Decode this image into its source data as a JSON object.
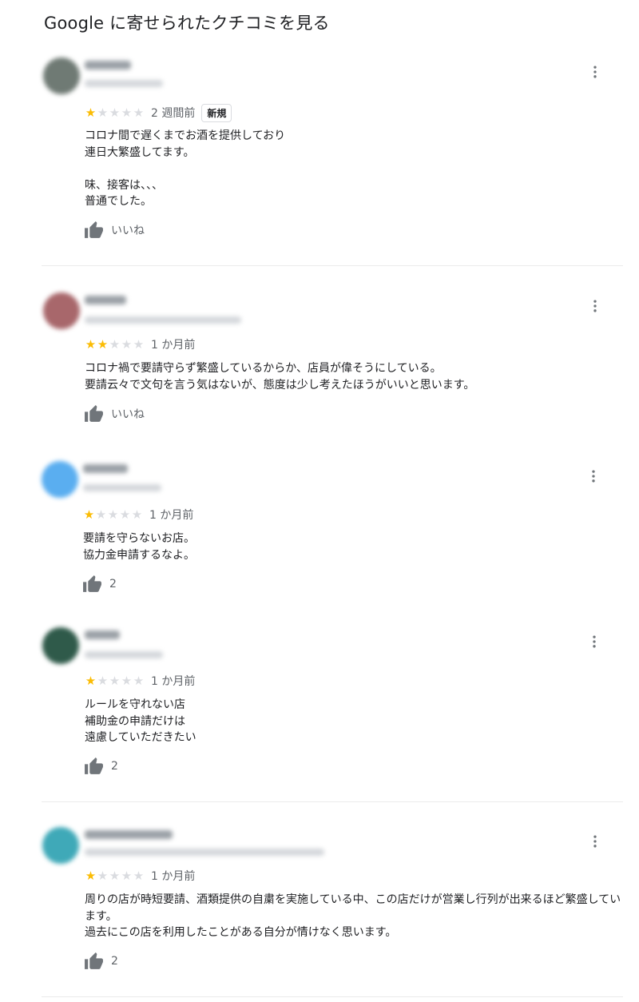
{
  "page_title": "Google に寄せられたクチコミを見る",
  "reviews": [
    {
      "rating": 1,
      "rating_max": 5,
      "time": "2 週間前",
      "badge": "新規",
      "text": "コロナ間で遅くまでお酒を提供しており\n連日大繁盛してます。\n\n味、接客は、、、\n普通でした。",
      "like_label": "いいね",
      "avatar_color": "#6f7a74"
    },
    {
      "rating": 2,
      "rating_max": 5,
      "time": "1 か月前",
      "text": "コロナ禍で要請守らず繁盛しているからか、店員が偉そうにしている。\n要請云々で文句を言う気はないが、態度は少し考えたほうがいいと思います。",
      "like_label": "いいね",
      "avatar_color": "#a8676b"
    },
    {
      "rating": 1,
      "rating_max": 5,
      "time": "1 か月前",
      "text": "要請を守らないお店。\n協力金申請するなよ。",
      "like_label": "2",
      "avatar_color": "#5aaef0"
    },
    {
      "rating": 1,
      "rating_max": 5,
      "time": "1 か月前",
      "text": "ルールを守れない店\n補助金の申請だけは\n遠慮していただきたい",
      "like_label": "2",
      "avatar_color": "#2f5a4a"
    },
    {
      "rating": 1,
      "rating_max": 5,
      "time": "1 か月前",
      "text": "周りの店が時短要請、酒類提供の自粛を実施している中、この店だけが営業し行列が出来るほど繁盛しています。\n過去にこの店を利用したことがある自分が情けなく思います。",
      "like_label": "2",
      "avatar_color": "#3fa9b8"
    }
  ],
  "colors": {
    "star_on": "#fbbc04",
    "star_off": "#dadce0",
    "text": "#202124",
    "secondary": "#5f6368",
    "icon": "#70757a"
  },
  "icons": {
    "more": "more-vert-icon",
    "like": "thumb-up-icon",
    "star": "star-icon"
  }
}
